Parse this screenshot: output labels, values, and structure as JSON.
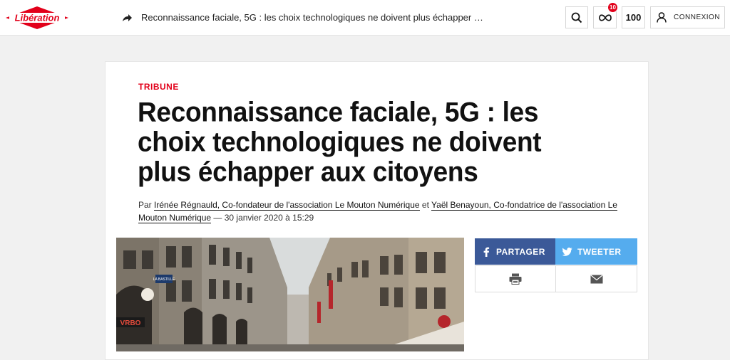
{
  "header": {
    "logo_text": "Libération",
    "headline": "Reconnaissance faciale, 5G : les choix technologiques ne doivent plus échapper …",
    "notification_count": "10",
    "counter": "100",
    "login_label": "CONNEXION",
    "icons": [
      "share-arrow-icon",
      "search-icon",
      "infinity-icon",
      "user-icon"
    ]
  },
  "article": {
    "kicker": "TRIBUNE",
    "title_lines": [
      "Reconnaissance faciale, 5G : les",
      "choix technologiques ne doivent",
      "plus échapper aux citoyens"
    ],
    "byline": {
      "prefix": "Par",
      "author1": "Irénée Régnauld, Co-fondateur de l'association Le Mouton Numérique",
      "joiner": "et",
      "author2": "Yaël Benayoun, Co-fondatrice de l'association Le Mouton Numérique",
      "date": "— 30 janvier 2020 à 15:29"
    },
    "photo_signs": [
      "LA BASTILLE",
      "VRBO"
    ]
  },
  "share": {
    "facebook_label": "PARTAGER",
    "twitter_label": "TWEETER",
    "icons": [
      "facebook-icon",
      "twitter-icon",
      "print-icon",
      "mail-icon"
    ]
  },
  "colors": {
    "accent": "#e2001a",
    "facebook": "#3b5998",
    "twitter": "#55acee",
    "background": "#f1f1f1"
  }
}
